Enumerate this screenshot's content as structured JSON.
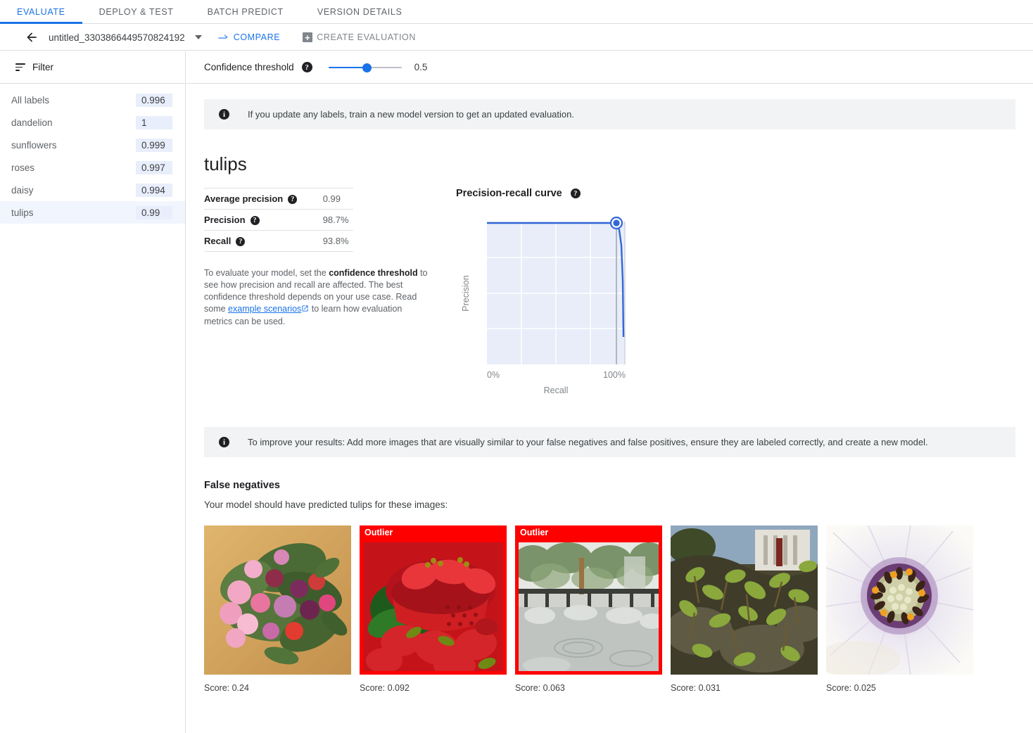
{
  "tabs": [
    {
      "label": "EVALUATE",
      "active": true
    },
    {
      "label": "DEPLOY & TEST",
      "active": false
    },
    {
      "label": "BATCH PREDICT",
      "active": false
    },
    {
      "label": "VERSION DETAILS",
      "active": false
    }
  ],
  "subheader": {
    "model_name": "untitled_3303866449570824192",
    "compare_label": "COMPARE",
    "create_evaluation_label": "CREATE EVALUATION"
  },
  "sidebar": {
    "filter_label": "Filter",
    "labels": [
      {
        "name": "All labels",
        "value": "0.996",
        "selected": false
      },
      {
        "name": "dandelion",
        "value": "1",
        "selected": false
      },
      {
        "name": "sunflowers",
        "value": "0.999",
        "selected": false
      },
      {
        "name": "roses",
        "value": "0.997",
        "selected": false
      },
      {
        "name": "daisy",
        "value": "0.994",
        "selected": false
      },
      {
        "name": "tulips",
        "value": "0.99",
        "selected": true
      }
    ]
  },
  "threshold": {
    "label": "Confidence threshold",
    "value": "0.5",
    "help": "?"
  },
  "banner_top": "If you update any labels, train a new model version to get an updated evaluation.",
  "banner_bottom": "To improve your results: Add more images that are visually similar to your false negatives and false positives, ensure they are labeled correctly, and create a new model.",
  "label_section": {
    "title": "tulips",
    "metrics": [
      {
        "name": "Average precision",
        "value": "0.99"
      },
      {
        "name": "Precision",
        "value": "98.7%"
      },
      {
        "name": "Recall",
        "value": "93.8%"
      }
    ],
    "description_part1": "To evaluate your model, set the ",
    "description_bold": "confidence threshold",
    "description_part2": " to see how precision and recall are affected. The best confidence threshold depends on your use case. Read some ",
    "description_link": "example scenarios",
    "description_part3": " to learn how evaluation metrics can be used."
  },
  "chart_data": {
    "type": "line",
    "title": "Precision-recall curve",
    "xlabel": "Recall",
    "ylabel": "Precision",
    "xticks": [
      "0%",
      "100%"
    ],
    "xlim": [
      0,
      100
    ],
    "ylim": [
      0,
      100
    ],
    "grid": true,
    "grid_x_divisions": 4,
    "grid_y_divisions": 4,
    "legend": "none",
    "series": [
      {
        "name": "Precision-recall",
        "x": [
          0,
          20,
          40,
          60,
          80,
          90,
          93.8,
          95,
          96,
          97,
          98.5,
          100
        ],
        "y": [
          100,
          100,
          100,
          100,
          100,
          99.5,
          98.7,
          96,
          90,
          75,
          45,
          20
        ]
      }
    ],
    "marker": {
      "x": 93.8,
      "y": 98.7,
      "label": "current threshold point"
    },
    "threshold_line_x": 93.8
  },
  "false_negatives": {
    "heading": "False negatives",
    "subtext": "Your model should have predicted tulips for these images:",
    "items": [
      {
        "alt": "bouquet of pink and purple tulips and ranunculus on wood floor",
        "outlier": false,
        "outlier_label": "",
        "score": "Score: 0.24",
        "art": "bouquet"
      },
      {
        "alt": "red colander full of strawberries",
        "outlier": true,
        "outlier_label": "Outlier",
        "score": "Score: 0.092",
        "art": "strawberries"
      },
      {
        "alt": "garden pond with rocks and fence",
        "outlier": true,
        "outlier_label": "Outlier",
        "score": "Score: 0.063",
        "art": "garden"
      },
      {
        "alt": "green leaves on mossy rock",
        "outlier": false,
        "outlier_label": "",
        "score": "Score: 0.031",
        "art": "leaves"
      },
      {
        "alt": "white daisy flower closeup",
        "outlier": false,
        "outlier_label": "",
        "score": "Score: 0.025",
        "art": "daisy"
      }
    ]
  },
  "colors": {
    "accent": "#1a73e8",
    "outlier": "#ff0000",
    "banner_bg": "#f1f3f4",
    "selected_row": "#f1f5fd",
    "chip_bg": "#e8eefb"
  }
}
